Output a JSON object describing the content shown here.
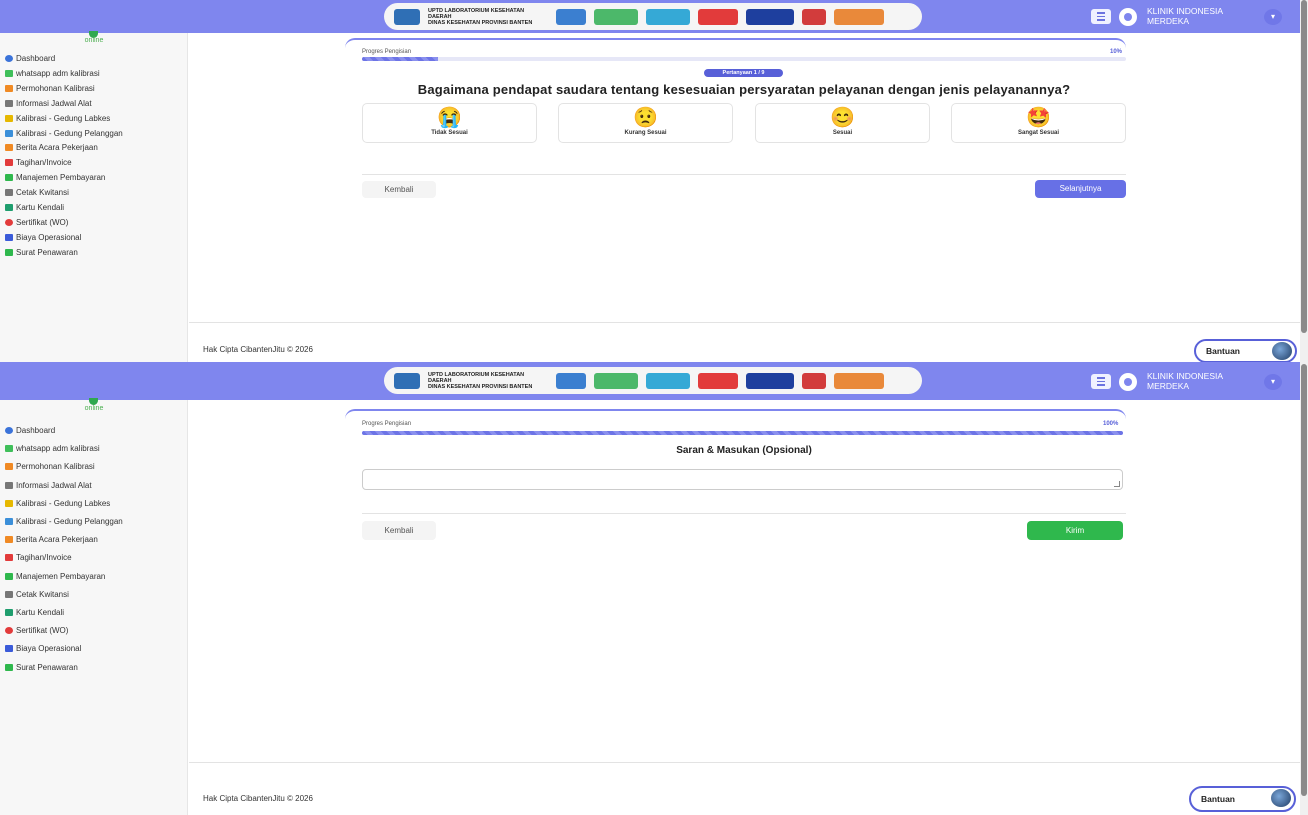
{
  "header": {
    "logo_text_line1": "UPTD LABORATORIUM KESEHATAN DAERAH",
    "logo_text_line2": "DINAS KESEHATAN PROVINSI BANTEN",
    "user_name": "KLINIK INDONESIA MERDEKA",
    "menu_icon": "hamburger-icon",
    "user_icon": "user-circle-icon",
    "caret_icon": "chevron-down-icon"
  },
  "sidebar": {
    "status": "online",
    "items": [
      {
        "label": "Dashboard",
        "icon": "dashboard-icon",
        "color": "#3b73d9"
      },
      {
        "label": "whatsapp adm kalibrasi",
        "icon": "whatsapp-icon",
        "color": "#3fbf5a"
      },
      {
        "label": "Permohonan Kalibrasi",
        "icon": "folder-icon",
        "color": "#f08a24"
      },
      {
        "label": "Informasi Jadwal Alat",
        "icon": "calendar-icon",
        "color": "#777777"
      },
      {
        "label": "Kalibrasi - Gedung Labkes",
        "icon": "hand-icon",
        "color": "#e6b800"
      },
      {
        "label": "Kalibrasi - Gedung Pelanggan",
        "icon": "hand-icon",
        "color": "#3b8fd9"
      },
      {
        "label": "Berita Acara Pekerjaan",
        "icon": "folder-icon",
        "color": "#f08a24"
      },
      {
        "label": "Tagihan/Invoice",
        "icon": "invoice-icon",
        "color": "#e23b3b"
      },
      {
        "label": "Manajemen Pembayaran",
        "icon": "money-icon",
        "color": "#2fb84d"
      },
      {
        "label": "Cetak Kwitansi",
        "icon": "printer-icon",
        "color": "#777777"
      },
      {
        "label": "Kartu Kendali",
        "icon": "card-icon",
        "color": "#1f9e6e"
      },
      {
        "label": "Sertifikat (WO)",
        "icon": "certificate-icon",
        "color": "#e23b3b"
      },
      {
        "label": "Biaya Operasional",
        "icon": "calculator-icon",
        "color": "#3b5bd9"
      },
      {
        "label": "Surat Penawaran",
        "icon": "send-icon",
        "color": "#2fb84d"
      }
    ]
  },
  "survey": {
    "progress_label": "Progres Pengisian",
    "progress_step1": {
      "percent_label": "10%",
      "fraction": 0.1
    },
    "question_badge": "Pertanyaan 1 / 9",
    "question_text": "Bagaimana pendapat saudara tentang kesesuaian persyaratan pelayanan dengan jenis pelayanannya?",
    "options": [
      {
        "label": "Tidak Sesuai",
        "emoji": "😭"
      },
      {
        "label": "Kurang Sesuai",
        "emoji": "😟"
      },
      {
        "label": "Sesuai",
        "emoji": "😊"
      },
      {
        "label": "Sangat Sesuai",
        "emoji": "🤩"
      }
    ],
    "back_label": "Kembali",
    "next_label": "Selanjutnya"
  },
  "feedback": {
    "progress_label": "Progres Pengisian",
    "progress_step2": {
      "percent_label": "100%",
      "fraction": 1.0
    },
    "title": "Saran & Masukan (Opsional)",
    "textarea_value": "",
    "back_label": "Kembali",
    "send_label": "Kirim"
  },
  "footer": {
    "copyright": "Hak Cipta CibantenJitu © 2026",
    "help_label": "Bantuan"
  },
  "colors": {
    "accent": "#7f86ee",
    "primary_button": "#6770e6",
    "success_button": "#2fb84d",
    "online": "#4caf50"
  }
}
